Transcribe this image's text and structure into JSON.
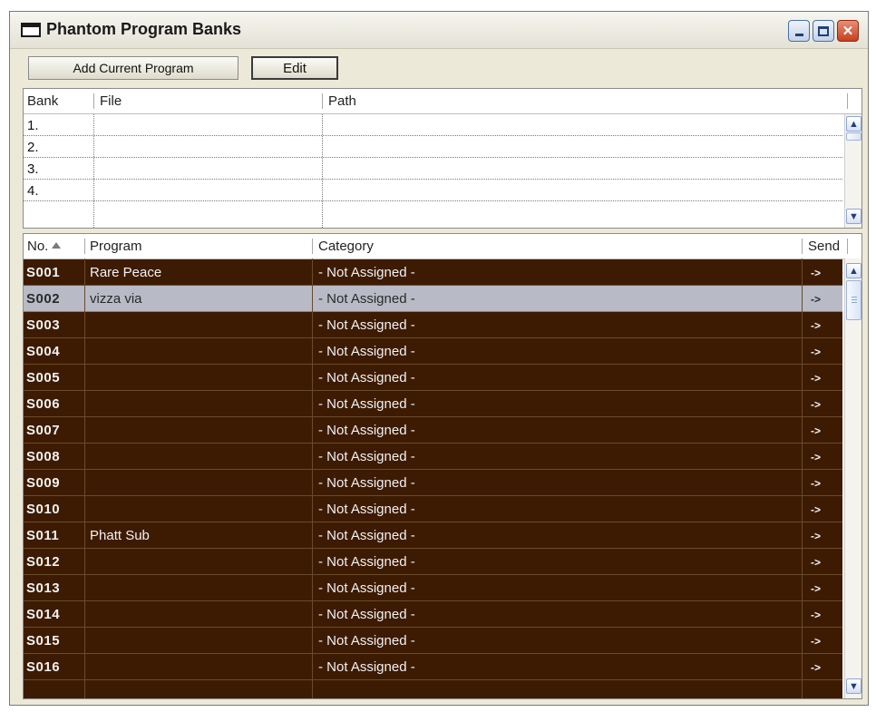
{
  "window": {
    "title": "Phantom Program Banks",
    "icons": {
      "app": "window-icon",
      "minimize": "minimize-icon",
      "maximize": "maximize-icon",
      "close": "close-icon"
    },
    "close_glyph": "✕"
  },
  "toolbar": {
    "add_label": "Add Current Program",
    "edit_label": "Edit"
  },
  "banks": {
    "columns": [
      "Bank",
      "File",
      "Path"
    ],
    "rows": [
      {
        "num": "1.",
        "file": "",
        "path": ""
      },
      {
        "num": "2.",
        "file": "",
        "path": ""
      },
      {
        "num": "3.",
        "file": "",
        "path": ""
      },
      {
        "num": "4.",
        "file": "",
        "path": ""
      }
    ]
  },
  "programs": {
    "columns": [
      "No.",
      "Program",
      "Category",
      "Send"
    ],
    "sort_icon": "sort-ascending-icon",
    "row_colors": {
      "normal_bg": "#3d1b03",
      "selected_bg": "#b8bbc6"
    },
    "rows": [
      {
        "no": "S001",
        "program": "Rare Peace",
        "category": "- Not Assigned -",
        "send": "->"
      },
      {
        "no": "S002",
        "program": "vizza via",
        "category": "- Not Assigned -",
        "send": "->"
      },
      {
        "no": "S003",
        "program": "",
        "category": "- Not Assigned -",
        "send": "->"
      },
      {
        "no": "S004",
        "program": "",
        "category": "- Not Assigned -",
        "send": "->"
      },
      {
        "no": "S005",
        "program": "",
        "category": "- Not Assigned -",
        "send": "->"
      },
      {
        "no": "S006",
        "program": "",
        "category": "- Not Assigned -",
        "send": "->"
      },
      {
        "no": "S007",
        "program": "",
        "category": "- Not Assigned -",
        "send": "->"
      },
      {
        "no": "S008",
        "program": "",
        "category": "- Not Assigned -",
        "send": "->"
      },
      {
        "no": "S009",
        "program": "",
        "category": "- Not Assigned -",
        "send": "->"
      },
      {
        "no": "S010",
        "program": "",
        "category": "- Not Assigned -",
        "send": "->"
      },
      {
        "no": "S011",
        "program": "Phatt Sub",
        "category": "- Not Assigned -",
        "send": "->"
      },
      {
        "no": "S012",
        "program": "",
        "category": "- Not Assigned -",
        "send": "->"
      },
      {
        "no": "S013",
        "program": "",
        "category": "- Not Assigned -",
        "send": "->"
      },
      {
        "no": "S014",
        "program": "",
        "category": "- Not Assigned -",
        "send": "->"
      },
      {
        "no": "S015",
        "program": "",
        "category": "- Not Assigned -",
        "send": "->"
      },
      {
        "no": "S016",
        "program": "",
        "category": "- Not Assigned -",
        "send": "->"
      }
    ],
    "selected_index": 1
  },
  "scroll": {
    "up_glyph": "▲",
    "down_glyph": "▼"
  }
}
